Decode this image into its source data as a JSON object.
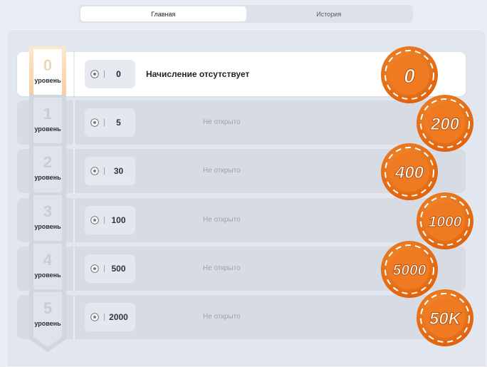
{
  "tabs": [
    {
      "label": "Главная",
      "active": true
    },
    {
      "label": "История",
      "active": false
    }
  ],
  "levels": [
    {
      "num": "0",
      "level_label": "уровень",
      "amount": "0",
      "status": "Начисление отсутствует",
      "chip": "0",
      "current": true
    },
    {
      "num": "1",
      "level_label": "уровень",
      "amount": "5",
      "status": "Не открыто",
      "chip": "200",
      "current": false
    },
    {
      "num": "2",
      "level_label": "уровень",
      "amount": "30",
      "status": "Не открыто",
      "chip": "400",
      "current": false
    },
    {
      "num": "3",
      "level_label": "уровень",
      "amount": "100",
      "status": "Не открыто",
      "chip": "1000",
      "current": false
    },
    {
      "num": "4",
      "level_label": "уровень",
      "amount": "500",
      "status": "Не открыто",
      "chip": "5000",
      "current": false
    },
    {
      "num": "5",
      "level_label": "уровень",
      "amount": "2000",
      "status": "Не открыто",
      "chip": "50K",
      "current": false
    }
  ],
  "colors": {
    "accent": "#f07a1c",
    "accent_dark": "#d9620f",
    "active_badge": "#f5c48a"
  }
}
